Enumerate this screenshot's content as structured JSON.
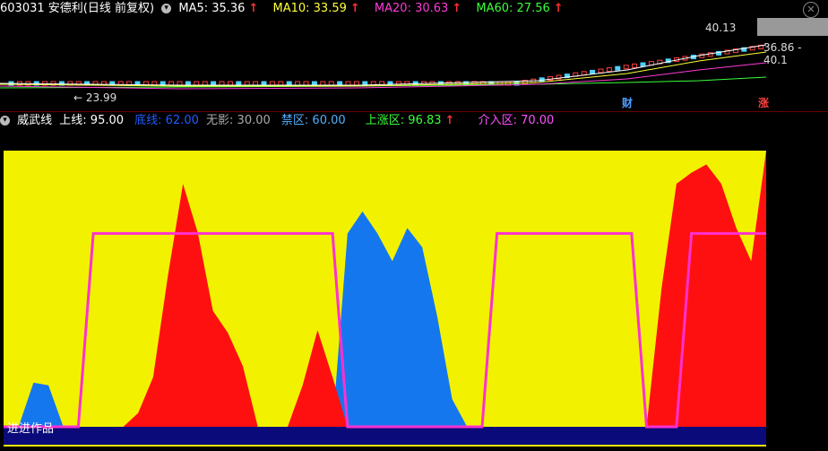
{
  "header": {
    "code_name": "603031 安德利(日线 前复权)",
    "ma5": "MA5: 35.36",
    "ma10": "MA10: 33.59",
    "ma20": "MA20: 30.63",
    "ma60": "MA60: 27.56",
    "up_arrow": "↑"
  },
  "price_panel": {
    "high_label": "40.13",
    "range_label": "36.86 - 40.1",
    "low_label": "← 23.99",
    "tag_cai": "财",
    "tag_zhang": "涨"
  },
  "indicator_header": {
    "name": "威武线",
    "shang_xian": "上线: 95.00",
    "di_xian": "底线: 62.00",
    "wu_ying": "无影: 30.00",
    "jin_qu": "禁区: 60.00",
    "shang_zhang_qu": "上涨区: 96.83",
    "jie_ru_qu": "介入区: 70.00"
  },
  "watermark_label": "进进作品",
  "colors": {
    "background": "#000000",
    "yellow_fill": "#f2f200",
    "red_fill": "#ff1010",
    "blue_fill": "#1577ee",
    "navy_band": "#0a0a7a",
    "magenta_line": "#ff30d0",
    "ma5": "#ffffff",
    "ma10": "#ffff3a",
    "ma20": "#ff3ad8",
    "ma60": "#3aff3a"
  },
  "chart_data": [
    {
      "type": "line",
      "title": "603031 安德利(日线 前复权)",
      "series": [
        {
          "name": "MA5",
          "last": 35.36
        },
        {
          "name": "MA10",
          "last": 33.59
        },
        {
          "name": "MA20",
          "last": 30.63
        },
        {
          "name": "MA60",
          "last": 27.56
        }
      ],
      "annotations": {
        "high": 40.13,
        "low": 23.99,
        "range": "36.86 - 40.1"
      }
    },
    {
      "type": "area",
      "title": "威武线",
      "x": [
        0,
        4,
        8,
        12,
        16,
        20,
        24,
        28,
        32,
        36,
        40,
        44,
        48,
        52,
        56,
        60,
        64,
        68,
        72,
        76,
        80,
        84,
        88,
        92,
        96,
        100,
        104,
        108,
        112,
        116,
        120,
        124,
        128,
        132,
        136,
        140,
        144,
        148,
        152,
        156,
        160,
        164,
        168,
        172,
        176,
        180,
        184,
        188,
        192,
        196,
        200,
        204
      ],
      "red_series": [
        0,
        0,
        0,
        0,
        0,
        0,
        0,
        0,
        0,
        5,
        18,
        55,
        88,
        70,
        42,
        34,
        22,
        0,
        0,
        0,
        15,
        35,
        18,
        0,
        0,
        0,
        0,
        0,
        0,
        0,
        0,
        0,
        0,
        0,
        0,
        0,
        0,
        0,
        0,
        0,
        0,
        0,
        0,
        0,
        50,
        88,
        92,
        95,
        88,
        72,
        60,
        100
      ],
      "blue_series": [
        0,
        0,
        16,
        15,
        0,
        0,
        0,
        0,
        0,
        0,
        0,
        0,
        0,
        0,
        0,
        0,
        0,
        0,
        0,
        0,
        0,
        0,
        0,
        70,
        78,
        70,
        60,
        72,
        65,
        40,
        10,
        0,
        0,
        0,
        0,
        0,
        0,
        0,
        0,
        0,
        0,
        0,
        0,
        0,
        0,
        0,
        0,
        0,
        0,
        0,
        0,
        0
      ],
      "magenta_line": [
        0,
        0,
        0,
        0,
        0,
        0,
        70,
        70,
        70,
        70,
        70,
        70,
        70,
        70,
        70,
        70,
        70,
        70,
        70,
        70,
        70,
        70,
        70,
        0,
        0,
        0,
        0,
        0,
        0,
        0,
        0,
        0,
        0,
        70,
        70,
        70,
        70,
        70,
        70,
        70,
        70,
        70,
        70,
        0,
        0,
        0,
        70,
        70,
        70,
        70,
        70,
        70
      ],
      "ylim": [
        0,
        100
      ],
      "levels": {
        "上线": 95.0,
        "底线": 62.0,
        "无影": 30.0,
        "禁区": 60.0,
        "上涨区": 96.83,
        "介入区": 70.0
      }
    }
  ]
}
